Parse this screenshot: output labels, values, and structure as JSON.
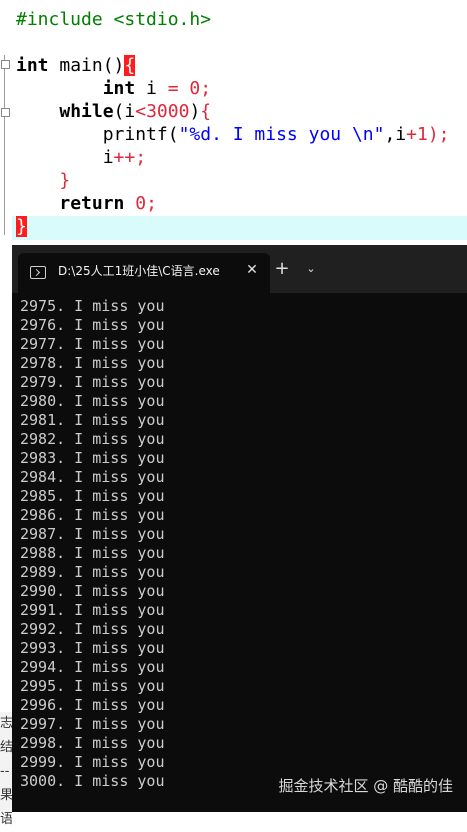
{
  "editor": {
    "include": "#include <stdio.h>",
    "main_kw": "int",
    "main_name": " main()",
    "main_brace": "{",
    "decl_kw": "int",
    "decl_rest_1": " i ",
    "decl_eq": "=",
    "decl_sp": " ",
    "decl_num": "0",
    "decl_semi": ";",
    "while_kw": "while",
    "while_open": "(i",
    "while_op": "<",
    "while_num": "3000",
    "while_close": ")",
    "while_brace": "{",
    "printf_name": "printf(",
    "printf_str": "\"%d. I miss you \\n\"",
    "printf_rest": ",i",
    "printf_plus": "+",
    "printf_num": "1",
    "printf_end": ");",
    "incr_var": "i",
    "incr_op": "++",
    "incr_semi": ";",
    "close_while": "}",
    "return_kw": "return",
    "return_num": "0",
    "return_semi": ";",
    "close_main": "}"
  },
  "console": {
    "tab_title": "D:\\25人工1班小佳\\C语言.exe",
    "close_glyph": "✕",
    "new_tab_glyph": "+",
    "dropdown_glyph": "⌄",
    "lines": [
      "2975. I miss you",
      "2976. I miss you",
      "2977. I miss you",
      "2978. I miss you",
      "2979. I miss you",
      "2980. I miss you",
      "2981. I miss you",
      "2982. I miss you",
      "2983. I miss you",
      "2984. I miss you",
      "2985. I miss you",
      "2986. I miss you",
      "2987. I miss you",
      "2988. I miss you",
      "2989. I miss you",
      "2990. I miss you",
      "2991. I miss you",
      "2992. I miss you",
      "2993. I miss you",
      "2994. I miss you",
      "2995. I miss you",
      "2996. I miss you",
      "2997. I miss you",
      "2998. I miss you",
      "2999. I miss you",
      "3000. I miss you"
    ]
  },
  "background_window": {
    "fragments": [
      "志",
      "结果",
      "---",
      "果:",
      "语"
    ]
  },
  "watermark": "掘金技术社区 @ 酷酷的佳",
  "colors": {
    "keyword": "#000000",
    "preprocessor": "#008000",
    "number": "#e0283a",
    "string": "#0000ff",
    "brace_highlight": "#ff1c1c",
    "current_line": "#d9fbfb",
    "console_bg": "#0c0c0c",
    "console_text": "#cccccc",
    "titlebar_bg": "#202020"
  }
}
